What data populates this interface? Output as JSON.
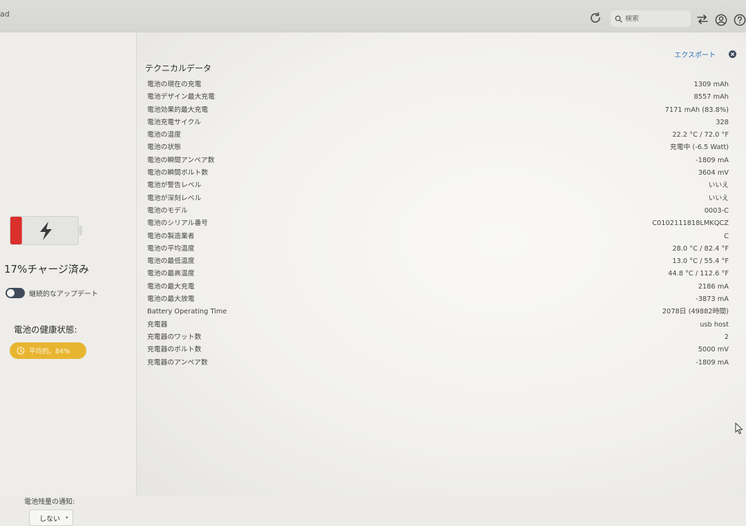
{
  "app": {
    "title_fragment": "ad"
  },
  "toolbar": {
    "search_placeholder": "検索",
    "icons": [
      "refresh-icon",
      "search-icon",
      "transfer-icon",
      "account-icon",
      "help-icon"
    ]
  },
  "sidebar": {
    "charge_text": "17%チャージ済み",
    "battery_level_percent": 17,
    "battery_level_color": "#d9302b",
    "continuous_update_label": "継続的なアップデート",
    "continuous_update_on": false,
    "health_heading": "電池の健康状態:",
    "health_badge_text": "平均的。84%",
    "health_badge_color": "#e8b531",
    "notify_label": "電池残量の通知:",
    "notify_value": "しない"
  },
  "main": {
    "export_label": "エクスポート",
    "section_title": "テクニカルデータ",
    "rows": [
      {
        "label": "電池の現在の充電",
        "value": "1309 mAh"
      },
      {
        "label": "電池デザイン最大充電",
        "value": "8557 mAh"
      },
      {
        "label": "電池効果的最大充電",
        "value": "7171 mAh (83.8%)"
      },
      {
        "label": "電池充電サイクル",
        "value": "328"
      },
      {
        "label": "電池の温度",
        "value": "22.2 °C / 72.0 °F"
      },
      {
        "label": "電池の状態",
        "value": "充電中 (-6.5 Watt)"
      },
      {
        "label": "電池の瞬間アンペア数",
        "value": "-1809 mA"
      },
      {
        "label": "電池の瞬間ボルト数",
        "value": "3604 mV"
      },
      {
        "label": "電池が警告レベル",
        "value": "いいえ"
      },
      {
        "label": "電池が深刻レベル",
        "value": "いいえ"
      },
      {
        "label": "電池のモデル",
        "value": "0003-C"
      },
      {
        "label": "電池のシリアル番号",
        "value": "C0102111818LMKQCZ"
      },
      {
        "label": "電池の製造業者",
        "value": "C"
      },
      {
        "label": "電池の平均温度",
        "value": "28.0 °C / 82.4 °F"
      },
      {
        "label": "電池の最低温度",
        "value": "13.0 °C / 55.4 °F"
      },
      {
        "label": "電池の最高温度",
        "value": "44.8 °C / 112.6 °F"
      },
      {
        "label": "電池の最大充電",
        "value": "2186 mA"
      },
      {
        "label": "電池の最大放電",
        "value": "-3873 mA"
      },
      {
        "label": "Battery Operating Time",
        "value": "2078日 (49882時間)"
      },
      {
        "label": "充電器",
        "value": "usb host"
      },
      {
        "label": "充電器のワット数",
        "value": "2"
      },
      {
        "label": "充電器のボルト数",
        "value": "5000 mV"
      },
      {
        "label": "充電器のアンペア数",
        "value": "-1809 mA"
      }
    ]
  }
}
